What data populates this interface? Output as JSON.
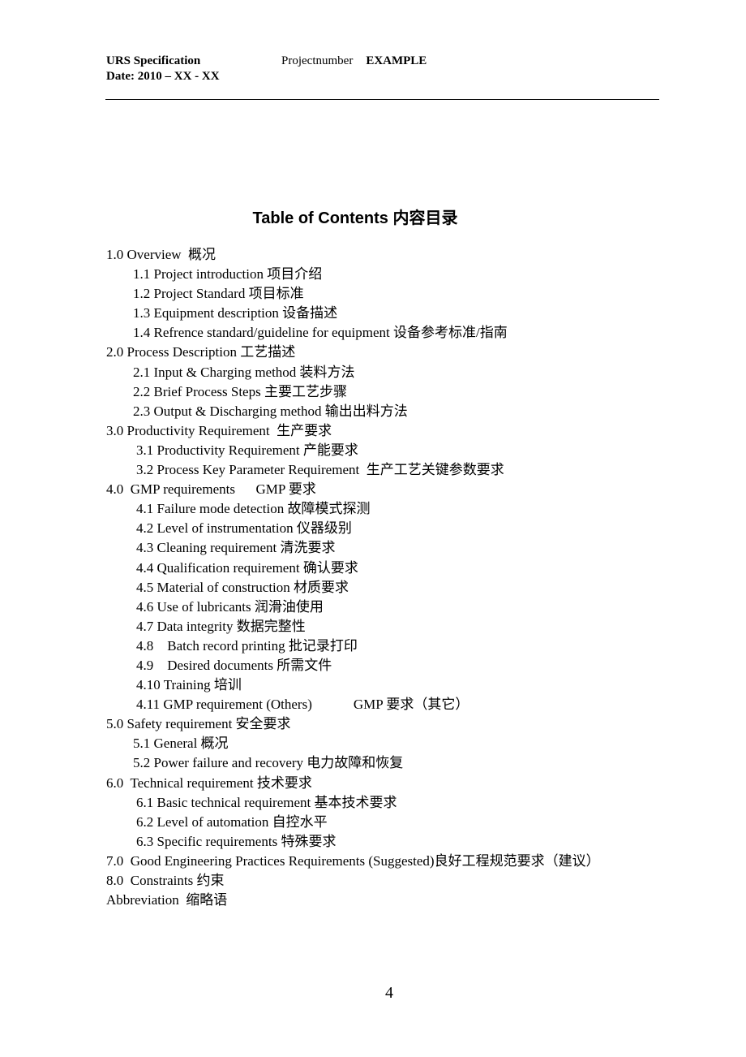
{
  "header": {
    "doc_title": "URS Specification",
    "date": "Date: 2010 – XX - XX",
    "project_label": "Projectnumber",
    "project_value": "EXAMPLE"
  },
  "title": "Table of Contents 内容目录",
  "toc": [
    {
      "level": 1,
      "text": "1.0 Overview  概况"
    },
    {
      "level": 2,
      "text": "1.1 Project introduction 项目介绍"
    },
    {
      "level": 2,
      "text": "1.2 Project Standard 项目标准"
    },
    {
      "level": 2,
      "text": "1.3 Equipment description 设备描述"
    },
    {
      "level": 2,
      "text": "1.4 Refrence standard/guideline for equipment 设备参考标准/指南"
    },
    {
      "level": 1,
      "text": "2.0 Process Description 工艺描述"
    },
    {
      "level": 2,
      "text": "2.1 Input & Charging method 装料方法"
    },
    {
      "level": 2,
      "text": "2.2 Brief Process Steps 主要工艺步骤"
    },
    {
      "level": 2,
      "text": "2.3 Output & Discharging method 输出出料方法"
    },
    {
      "level": 1,
      "text": "3.0 Productivity Requirement  生产要求"
    },
    {
      "level": 2,
      "text": "3.1 Productivity Requirement 产能要求"
    },
    {
      "level": 2,
      "text": "3.2 Process Key Parameter Requirement  生产工艺关键参数要求"
    },
    {
      "level": 1,
      "text": "4.0  GMP requirements      GMP 要求"
    },
    {
      "level": 2,
      "text": "4.1 Failure mode detection 故障模式探测"
    },
    {
      "level": 2,
      "text": "4.2 Level of instrumentation 仪器级别"
    },
    {
      "level": 2,
      "text": "4.3 Cleaning requirement 清洗要求"
    },
    {
      "level": 2,
      "text": "4.4 Qualification requirement 确认要求"
    },
    {
      "level": 2,
      "text": "4.5 Material of construction 材质要求"
    },
    {
      "level": 2,
      "text": "4.6 Use of lubricants 润滑油使用"
    },
    {
      "level": 2,
      "text": "4.7 Data integrity 数据完整性"
    },
    {
      "level": 2,
      "text": "4.8    Batch record printing 批记录打印"
    },
    {
      "level": 2,
      "text": "4.9    Desired documents 所需文件"
    },
    {
      "level": 2,
      "text": "4.10 Training 培训"
    },
    {
      "level": 2,
      "text": "4.11 GMP requirement (Others)            GMP 要求（其它）"
    },
    {
      "level": 1,
      "text": "5.0 Safety requirement 安全要求"
    },
    {
      "level": 2,
      "text": "5.1 General 概况"
    },
    {
      "level": 2,
      "text": "5.2 Power failure and recovery 电力故障和恢复"
    },
    {
      "level": 1,
      "text": "6.0  Technical requirement 技术要求"
    },
    {
      "level": 2,
      "text": "6.1 Basic technical requirement 基本技术要求"
    },
    {
      "level": 2,
      "text": "6.2 Level of automation 自控水平"
    },
    {
      "level": 2,
      "text": "6.3 Specific requirements 特殊要求"
    },
    {
      "level": 1,
      "text": "7.0  Good Engineering Practices Requirements (Suggested)良好工程规范要求（建议）"
    },
    {
      "level": 1,
      "text": "8.0  Constraints 约束"
    },
    {
      "level": 1,
      "text": "Abbreviation  缩略语"
    }
  ],
  "page_number": "4"
}
